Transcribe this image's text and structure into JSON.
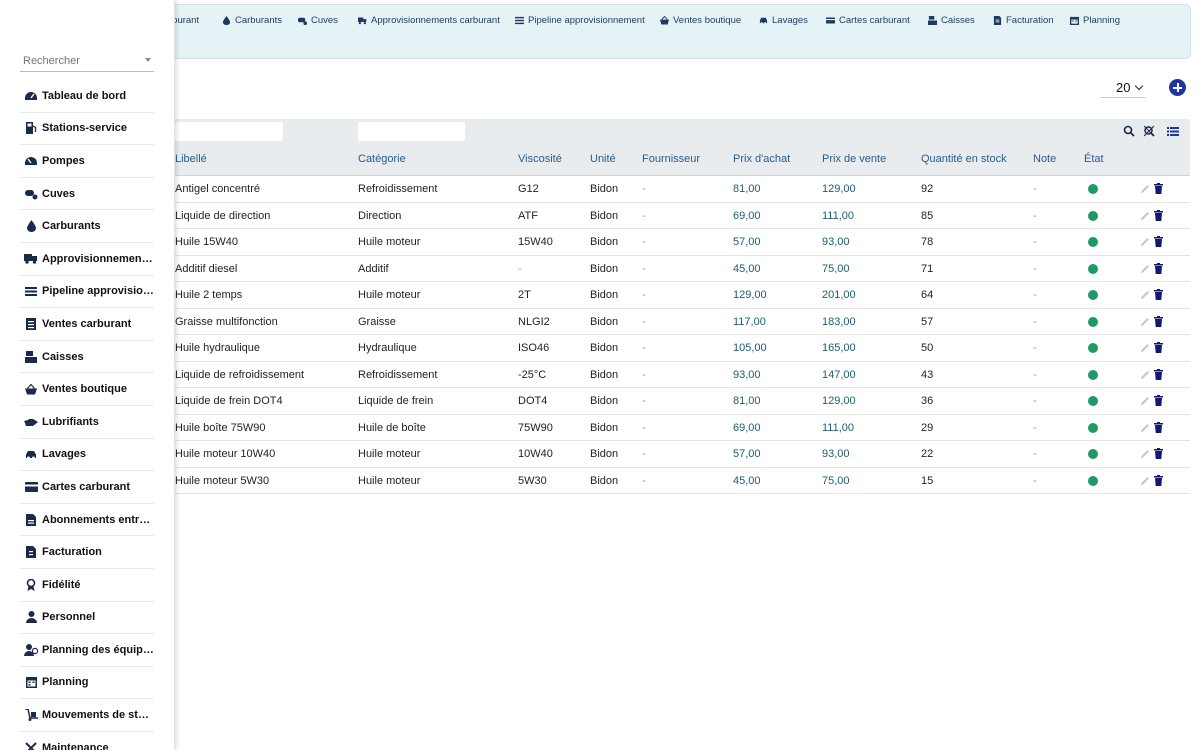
{
  "topnav": [
    {
      "label": "rburant",
      "icon": "pump-icon"
    },
    {
      "label": "Carburants",
      "icon": "drop-icon"
    },
    {
      "label": "Cuves",
      "icon": "tank-icon"
    },
    {
      "label": "Approvisionnements carburant",
      "icon": "truck-icon"
    },
    {
      "label": "Pipeline approvisionnement",
      "icon": "list-icon"
    },
    {
      "label": "Ventes boutique",
      "icon": "basket-icon"
    },
    {
      "label": "Lavages",
      "icon": "car-icon"
    },
    {
      "label": "Cartes carburant",
      "icon": "card-icon"
    },
    {
      "label": "Caisses",
      "icon": "register-icon"
    },
    {
      "label": "Facturation",
      "icon": "invoice-icon"
    },
    {
      "label": "Planning",
      "icon": "calendar-icon"
    }
  ],
  "search": {
    "placeholder": "Rechercher"
  },
  "sidebar": {
    "items": [
      {
        "label": "Tableau de bord",
        "icon": "dashboard-icon"
      },
      {
        "label": "Stations-service",
        "icon": "station-icon"
      },
      {
        "label": "Pompes",
        "icon": "gauge-icon"
      },
      {
        "label": "Cuves",
        "icon": "tank-icon"
      },
      {
        "label": "Carburants",
        "icon": "drop-icon"
      },
      {
        "label": "Approvisionnements…",
        "icon": "truck-icon"
      },
      {
        "label": "Pipeline approvision…",
        "icon": "list-icon"
      },
      {
        "label": "Ventes carburant",
        "icon": "receipt-icon"
      },
      {
        "label": "Caisses",
        "icon": "register-icon"
      },
      {
        "label": "Ventes boutique",
        "icon": "basket-icon"
      },
      {
        "label": "Lubrifiants",
        "icon": "oilcan-icon"
      },
      {
        "label": "Lavages",
        "icon": "car-icon"
      },
      {
        "label": "Cartes carburant",
        "icon": "card-icon"
      },
      {
        "label": "Abonnements entrep…",
        "icon": "subscription-icon"
      },
      {
        "label": "Facturation",
        "icon": "invoice-icon"
      },
      {
        "label": "Fidélité",
        "icon": "award-icon"
      },
      {
        "label": "Personnel",
        "icon": "user-icon"
      },
      {
        "label": "Planning des équipes",
        "icon": "team-icon"
      },
      {
        "label": "Planning",
        "icon": "calendar-icon"
      },
      {
        "label": "Mouvements de stock",
        "icon": "dolly-icon"
      },
      {
        "label": "Maintenance",
        "icon": "tools-icon"
      }
    ]
  },
  "pagination": {
    "page_size": "20"
  },
  "table": {
    "columns": [
      "Libellé",
      "Catégorie",
      "Viscosité",
      "Unité",
      "Fournisseur",
      "Prix d'achat",
      "Prix de vente",
      "Quantité en stock",
      "Note",
      "État"
    ],
    "rows": [
      [
        "Antigel concentré",
        "Refroidissement",
        "G12",
        "Bidon",
        "-",
        "81,00",
        "129,00",
        "92",
        "-"
      ],
      [
        "Liquide de direction",
        "Direction",
        "ATF",
        "Bidon",
        "-",
        "69,00",
        "111,00",
        "85",
        "-"
      ],
      [
        "Huile 15W40",
        "Huile moteur",
        "15W40",
        "Bidon",
        "-",
        "57,00",
        "93,00",
        "78",
        "-"
      ],
      [
        "Additif diesel",
        "Additif",
        "-",
        "Bidon",
        "-",
        "45,00",
        "75,00",
        "71",
        "-"
      ],
      [
        "Huile 2 temps",
        "Huile moteur",
        "2T",
        "Bidon",
        "-",
        "129,00",
        "201,00",
        "64",
        "-"
      ],
      [
        "Graisse multifonction",
        "Graisse",
        "NLGI2",
        "Bidon",
        "-",
        "117,00",
        "183,00",
        "57",
        "-"
      ],
      [
        "Huile hydraulique",
        "Hydraulique",
        "ISO46",
        "Bidon",
        "-",
        "105,00",
        "165,00",
        "50",
        "-"
      ],
      [
        "Liquide de refroidissement",
        "Refroidissement",
        "-25°C",
        "Bidon",
        "-",
        "93,00",
        "147,00",
        "43",
        "-"
      ],
      [
        "Liquide de frein DOT4",
        "Liquide de frein",
        "DOT4",
        "Bidon",
        "-",
        "81,00",
        "129,00",
        "36",
        "-"
      ],
      [
        "Huile boîte 75W90",
        "Huile de boîte",
        "75W90",
        "Bidon",
        "-",
        "69,00",
        "111,00",
        "29",
        "-"
      ],
      [
        "Huile moteur 10W40",
        "Huile moteur",
        "10W40",
        "Bidon",
        "-",
        "57,00",
        "93,00",
        "22",
        "-"
      ],
      [
        "Huile moteur 5W30",
        "Huile moteur",
        "5W30",
        "Bidon",
        "-",
        "45,00",
        "75,00",
        "15",
        "-"
      ]
    ]
  },
  "colors": {
    "accent": "#1f35a3",
    "status_active": "#1f9a65",
    "header_text": "#2a5b8a",
    "price_text": "#1a5e70"
  }
}
